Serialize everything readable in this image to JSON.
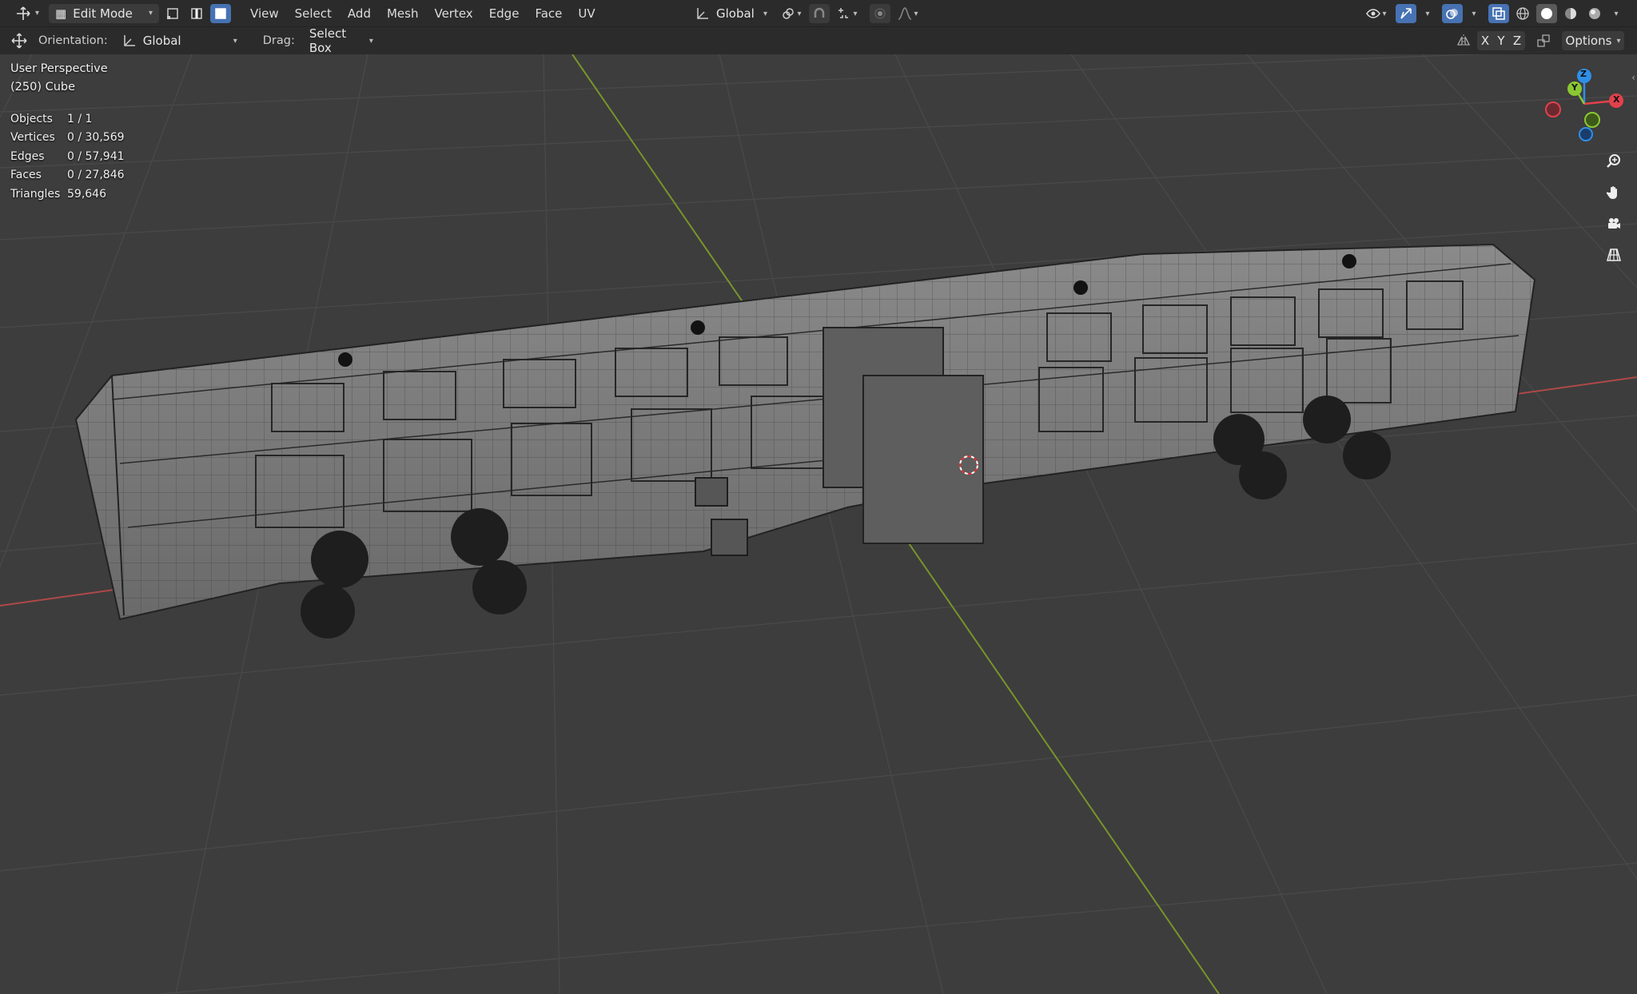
{
  "header": {
    "mode_label": "Edit Mode",
    "menus": [
      "View",
      "Select",
      "Add",
      "Mesh",
      "Vertex",
      "Edge",
      "Face",
      "UV"
    ],
    "transform_orientation": "Global"
  },
  "tool_header": {
    "orientation_label": "Orientation:",
    "orientation_value": "Global",
    "drag_label": "Drag:",
    "drag_value": "Select Box",
    "axis_x": "X",
    "axis_y": "Y",
    "axis_z": "Z",
    "options_label": "Options"
  },
  "viewport": {
    "view_name": "User Perspective",
    "object_info": "(250) Cube",
    "stats": [
      {
        "label": "Objects",
        "value": "1 / 1"
      },
      {
        "label": "Vertices",
        "value": "0 / 30,569"
      },
      {
        "label": "Edges",
        "value": "0 / 57,941"
      },
      {
        "label": "Faces",
        "value": "0 / 27,846"
      },
      {
        "label": "Triangles",
        "value": "59,646"
      }
    ]
  },
  "gizmo": {
    "x": "X",
    "y": "Y",
    "z": "Z"
  },
  "colors": {
    "header_bg": "#2b2b2b",
    "viewport_bg": "#3d3d3d",
    "active_blue": "#4772b3",
    "axis_x_red": "#e2414c",
    "axis_y_green": "#8ac832",
    "axis_z_blue": "#2f8fe8"
  },
  "icons": [
    "transform-icon",
    "vertex-select-icon",
    "edge-select-icon",
    "face-select-icon",
    "orientation-icon",
    "pivot-icon",
    "snap-icon",
    "proportional-icon",
    "visibility-icon",
    "gizmo-icon",
    "overlay-icon",
    "xray-icon",
    "wireframe-shading-icon",
    "solid-shading-icon",
    "material-shading-icon",
    "rendered-shading-icon",
    "zoom-icon",
    "hand-pan-icon",
    "camera-icon",
    "grid-perspective-icon"
  ]
}
